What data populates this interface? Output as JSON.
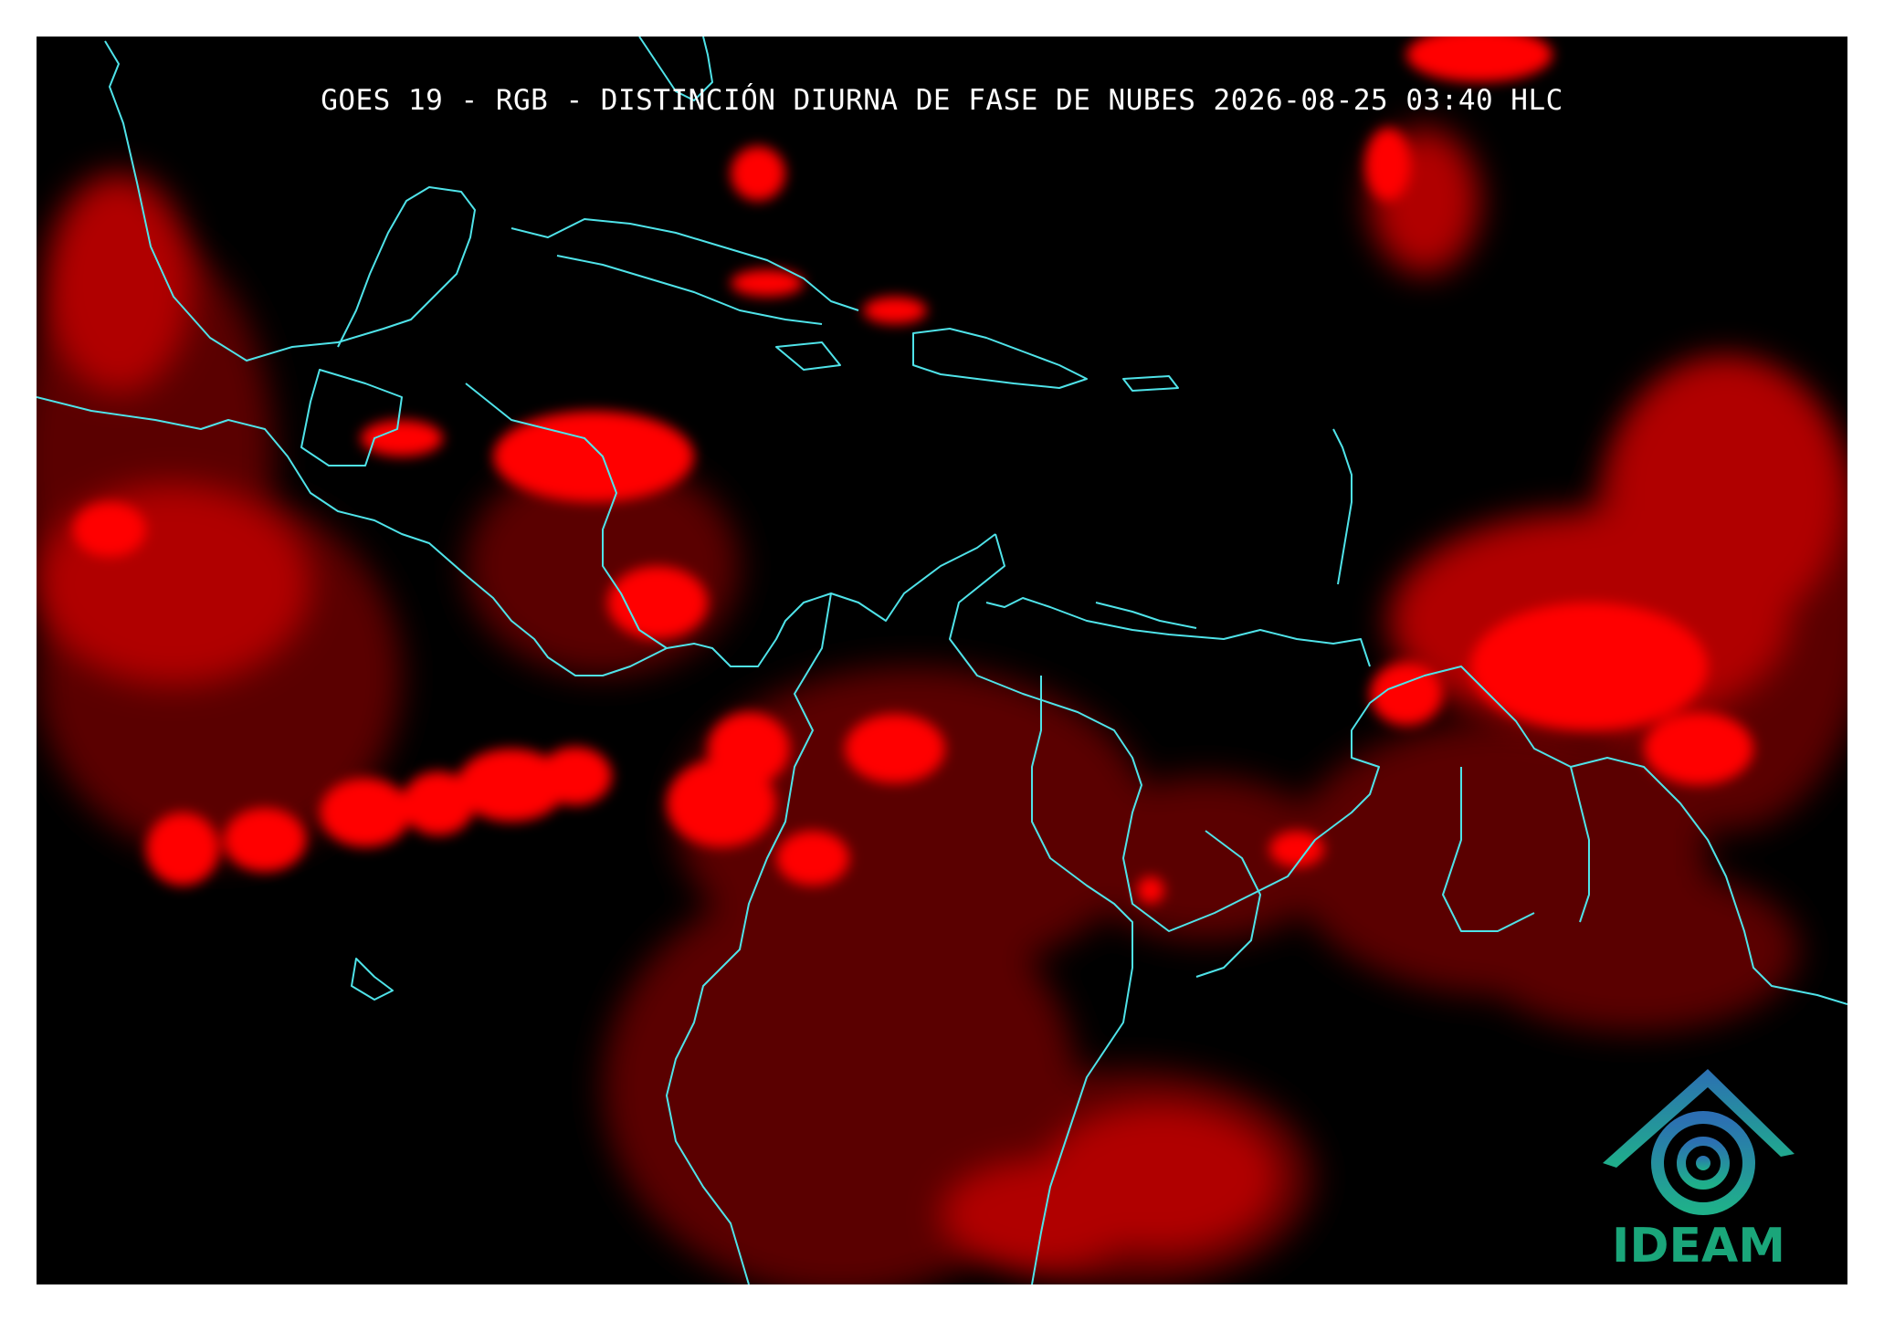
{
  "title": "GOES 19 - RGB - DISTINCIÓN DIURNA DE FASE DE NUBES 2026-08-25 03:40 HLC",
  "logo": {
    "text": "IDEAM",
    "icon": "ideam-mountain-swirl-logo"
  },
  "colors": {
    "background": "#000000",
    "coastline": "#4fe3e9",
    "cloud": "#ff0000",
    "logo_text": "#1aa67a",
    "logo_gradient_top": "#2c6fb3",
    "logo_gradient_bottom": "#1fb08a"
  }
}
